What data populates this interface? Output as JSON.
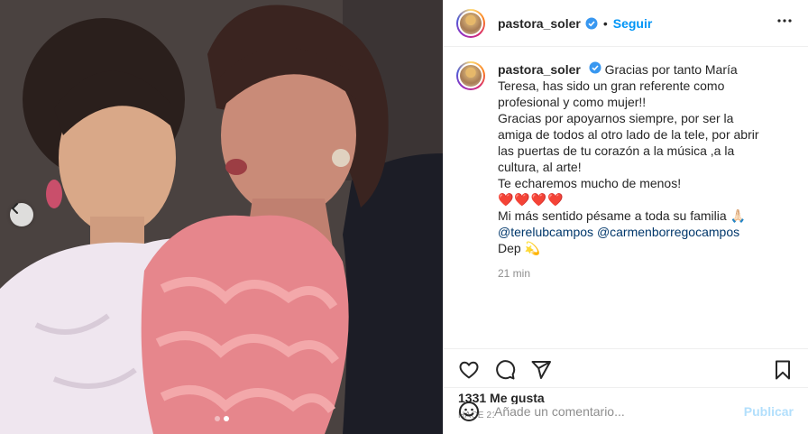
{
  "post": {
    "username": "pastora_soler",
    "follow_label": "Seguir",
    "separator": "•",
    "caption_lines": [
      "Gracias por tanto María",
      "Teresa, has sido un gran referente como",
      "profesional y como mujer!!",
      "Gracias por apoyarnos siempre, por ser la",
      "amiga de todos al otro lado de la tele, por abrir",
      "las puertas de tu corazón a la música ,a la",
      "cultura, al arte!",
      "Te echaremos mucho de menos!"
    ],
    "hearts": "❤️❤️❤️❤️",
    "condolence": "Mi más sentido pésame a toda su familia 🙏🏻",
    "mention_1": "@terelubcampos",
    "mention_2": "@carmenborregocampos",
    "sign_off": "Dep 💫",
    "caption_time": "21 min",
    "likes": "1331 Me gusta",
    "posted_ago": "HACE 21 MINUTOS",
    "carousel": {
      "total": 2,
      "current": 2
    }
  },
  "comment": {
    "placeholder": "Añade un comentario...",
    "publish_label": "Publicar"
  },
  "icons": {
    "verified": "verified-badge-icon",
    "more": "more-options-icon",
    "like": "heart-icon",
    "comment": "comment-icon",
    "share": "share-icon",
    "save": "bookmark-icon",
    "emoji": "emoji-icon",
    "prev": "chevron-left-icon"
  },
  "colors": {
    "link": "#0095f6",
    "publish_disabled": "#b2dffc",
    "verified": "#3897f0"
  }
}
